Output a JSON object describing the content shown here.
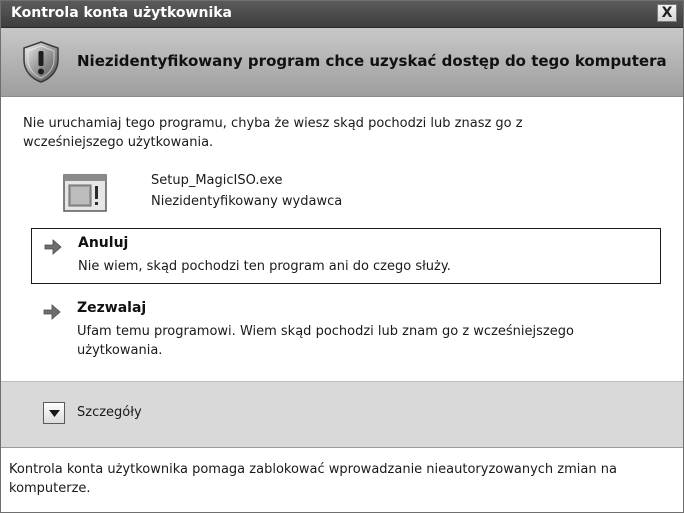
{
  "window": {
    "title": "Kontrola konta użytkownika",
    "close_glyph": "X"
  },
  "header": {
    "icon": "shield-warning-icon",
    "title": "Niezidentyfikowany program chce uzyskać dostęp do tego komputera"
  },
  "body": {
    "intro": "Nie uruchamiaj tego programu, chyba że wiesz skąd pochodzi lub znasz go z wcześniejszego użytkowania.",
    "program": {
      "icon": "program-window-icon",
      "name": "Setup_MagicISO.exe",
      "publisher": "Niezidentyfikowany wydawca"
    }
  },
  "options": {
    "cancel": {
      "icon": "arrow-right-icon",
      "title": "Anuluj",
      "description": "Nie wiem, skąd pochodzi ten program ani do czego służy."
    },
    "allow": {
      "icon": "arrow-right-icon",
      "title": "Zezwalaj",
      "description": "Ufam temu programowi. Wiem skąd pochodzi lub znam go z wcześniejszego użytkowania."
    }
  },
  "details": {
    "icon": "chevron-down-icon",
    "label": "Szczegóły"
  },
  "footer": {
    "text": "Kontrola konta użytkownika pomaga zablokować wprowadzanie nieautoryzowanych zmian na komputerze."
  },
  "colors": {
    "titlebar": "#4a4a4a",
    "header_band": "#b4b4b4",
    "details_band": "#d9d9d9",
    "arrow": "#666666"
  }
}
